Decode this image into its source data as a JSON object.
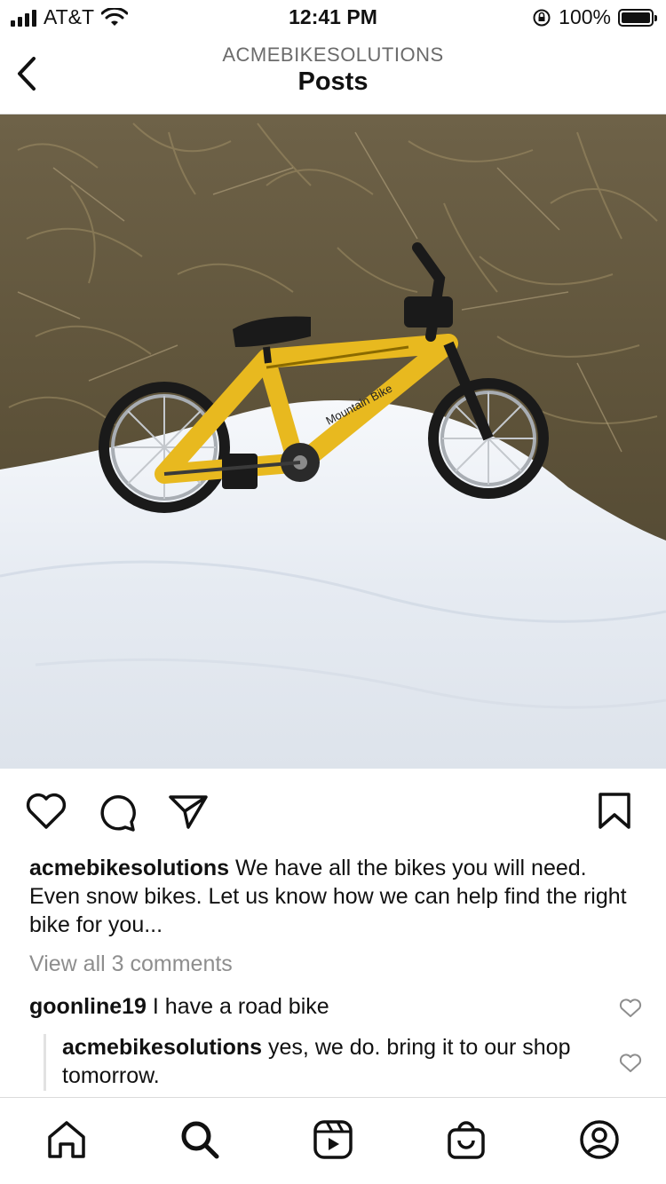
{
  "status": {
    "carrier": "AT&T",
    "time": "12:41 PM",
    "battery": "100%"
  },
  "header": {
    "account": "ACMEBIKESOLUTIONS",
    "title": "Posts"
  },
  "post": {
    "image_alt": "Yellow toy mountain bike on snow",
    "bike_text": "Mountain Bike",
    "caption_user": "acmebikesolutions",
    "caption_text": " We have all the bikes you will need. Even snow bikes. Let us know how we can help find the right bike for you...",
    "view_all": "View all 3 comments",
    "comments": [
      {
        "user": "goonline19",
        "text": " I have a road bike"
      },
      {
        "user": "acmebikesolutions",
        "text": " yes, we do. bring it to our shop tomorrow."
      }
    ]
  },
  "icons": {
    "back": "chevron-left-icon",
    "like": "heart-icon",
    "comment": "comment-icon",
    "share": "paper-plane-icon",
    "save": "bookmark-icon",
    "home": "home-icon",
    "search": "search-icon",
    "reels": "reels-icon",
    "shop": "shopping-bag-icon",
    "profile": "profile-icon"
  }
}
